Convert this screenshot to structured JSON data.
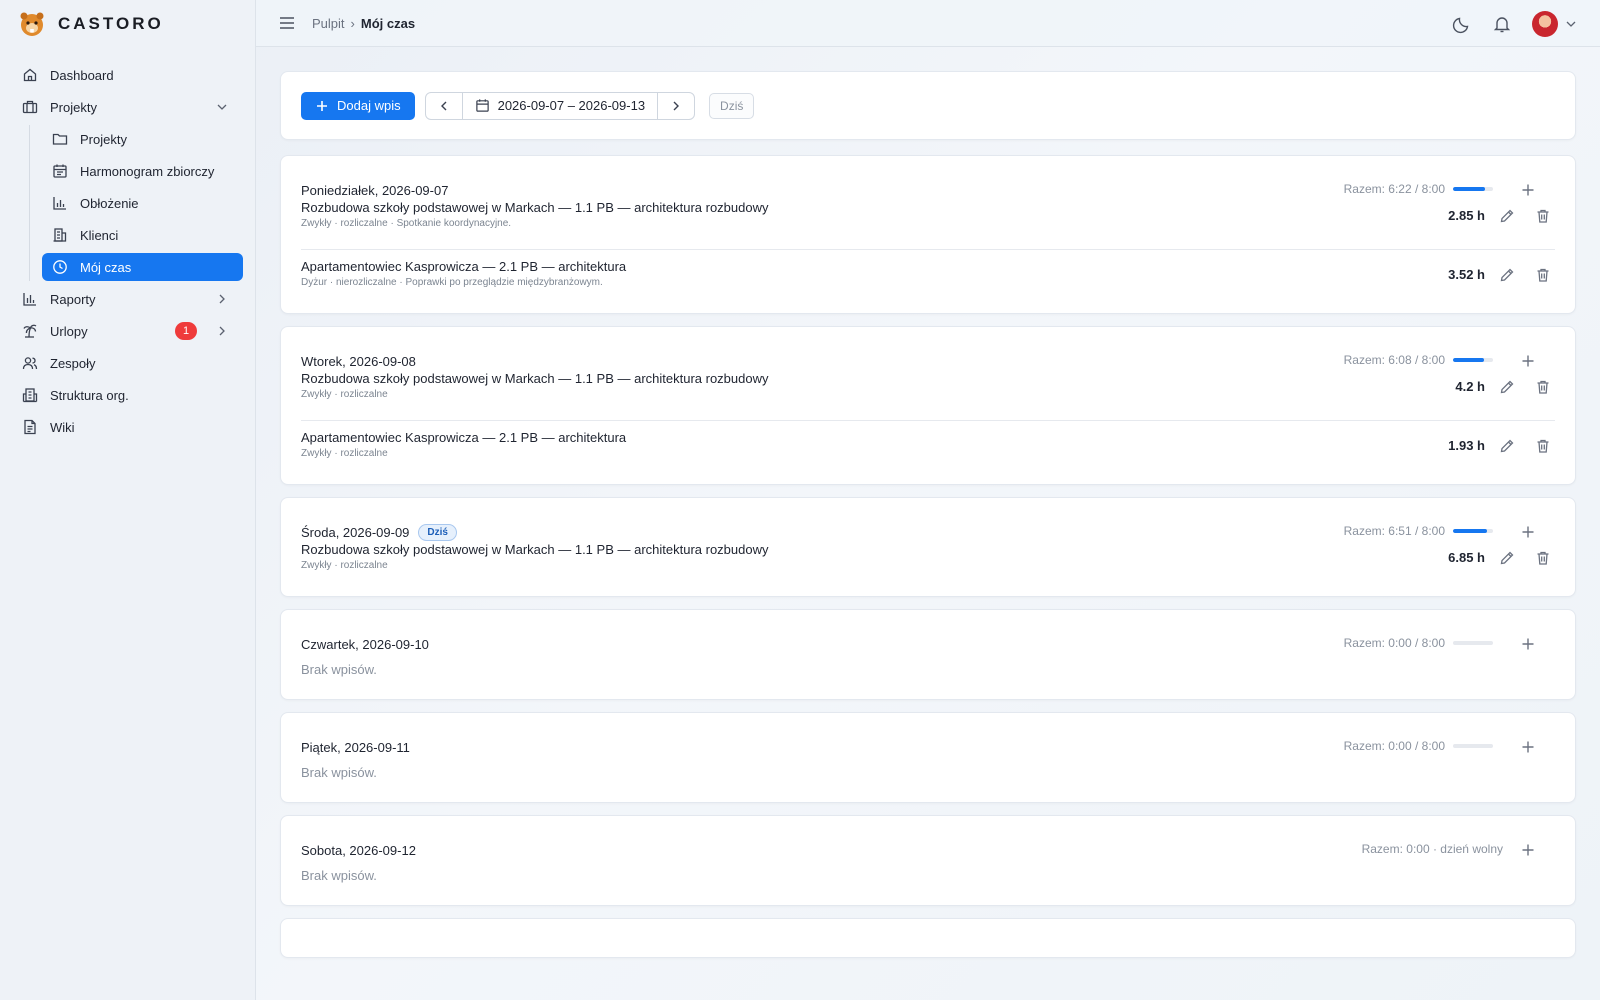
{
  "app": {
    "name": "CASTORO"
  },
  "sidebar": {
    "items": [
      {
        "label": "Dashboard",
        "icon": "home-icon"
      },
      {
        "label": "Projekty",
        "icon": "briefcase-icon"
      },
      {
        "label": "Raporty",
        "icon": "bar-chart-icon"
      },
      {
        "label": "Urlopy",
        "icon": "palm-tree-icon",
        "badge": "1"
      },
      {
        "label": "Zespoły",
        "icon": "users-icon"
      },
      {
        "label": "Struktura org.",
        "icon": "org-structure-icon"
      },
      {
        "label": "Wiki",
        "icon": "document-icon"
      }
    ],
    "sub_items": [
      {
        "label": "Projekty",
        "icon": "folder-icon"
      },
      {
        "label": "Harmonogram zbiorczy",
        "icon": "calendar-icon"
      },
      {
        "label": "Obłożenie",
        "icon": "chart-icon"
      },
      {
        "label": "Klienci",
        "icon": "building-icon"
      },
      {
        "label": "Mój czas",
        "icon": "clock-icon",
        "active": true
      }
    ]
  },
  "topbar": {
    "breadcrumb_root": "Pulpit",
    "breadcrumb_sep": "›",
    "breadcrumb_current": "Mój czas"
  },
  "toolbar": {
    "add_label": "Dodaj wpis",
    "date_range": "2026-09-07 – 2026-09-13",
    "today_label": "Dziś"
  },
  "days": [
    {
      "title": "Poniedziałek, 2026-09-07",
      "summary": "Razem: 6:22 / 8:00",
      "progress": 0.8,
      "entries": [
        {
          "title": "Rozbudowa szkoły podstawowej w Markach — 1.1 PB — architektura rozbudowy",
          "sub": "Zwykły · rozliczalne · Spotkanie koordynacyjne.",
          "hours": "2.85 h"
        },
        {
          "title": "Apartamentowiec Kasprowicza — 2.1 PB — architektura",
          "sub": "Dyżur · nierozliczalne · Poprawki po przeglądzie międzybranżowym.",
          "hours": "3.52 h"
        }
      ]
    },
    {
      "title": "Wtorek, 2026-09-08",
      "summary": "Razem: 6:08 / 8:00",
      "progress": 0.77,
      "entries": [
        {
          "title": "Rozbudowa szkoły podstawowej w Markach — 1.1 PB — architektura rozbudowy",
          "sub": "Zwykły · rozliczalne",
          "hours": "4.2 h"
        },
        {
          "title": "Apartamentowiec Kasprowicza — 2.1 PB — architektura",
          "sub": "Zwykły · rozliczalne",
          "hours": "1.93 h"
        }
      ]
    },
    {
      "title": "Środa, 2026-09-09",
      "today_badge": "Dziś",
      "summary": "Razem: 6:51 / 8:00",
      "progress": 0.86,
      "entries": [
        {
          "title": "Rozbudowa szkoły podstawowej w Markach — 1.1 PB — architektura rozbudowy",
          "sub": "Zwykły · rozliczalne",
          "hours": "6.85 h"
        }
      ]
    },
    {
      "title": "Czwartek, 2026-09-10",
      "summary": "Razem: 0:00 / 8:00",
      "progress": 0,
      "empty": "Brak wpisów."
    },
    {
      "title": "Piątek, 2026-09-11",
      "summary": "Razem: 0:00 / 8:00",
      "progress": 0,
      "empty": "Brak wpisów."
    },
    {
      "title": "Sobota, 2026-09-12",
      "summary": "Razem: 0:00 · dzień wolny",
      "empty": "Brak wpisów."
    }
  ],
  "colors": {
    "accent": "#1677f0",
    "badge": "#ef3b3b"
  }
}
